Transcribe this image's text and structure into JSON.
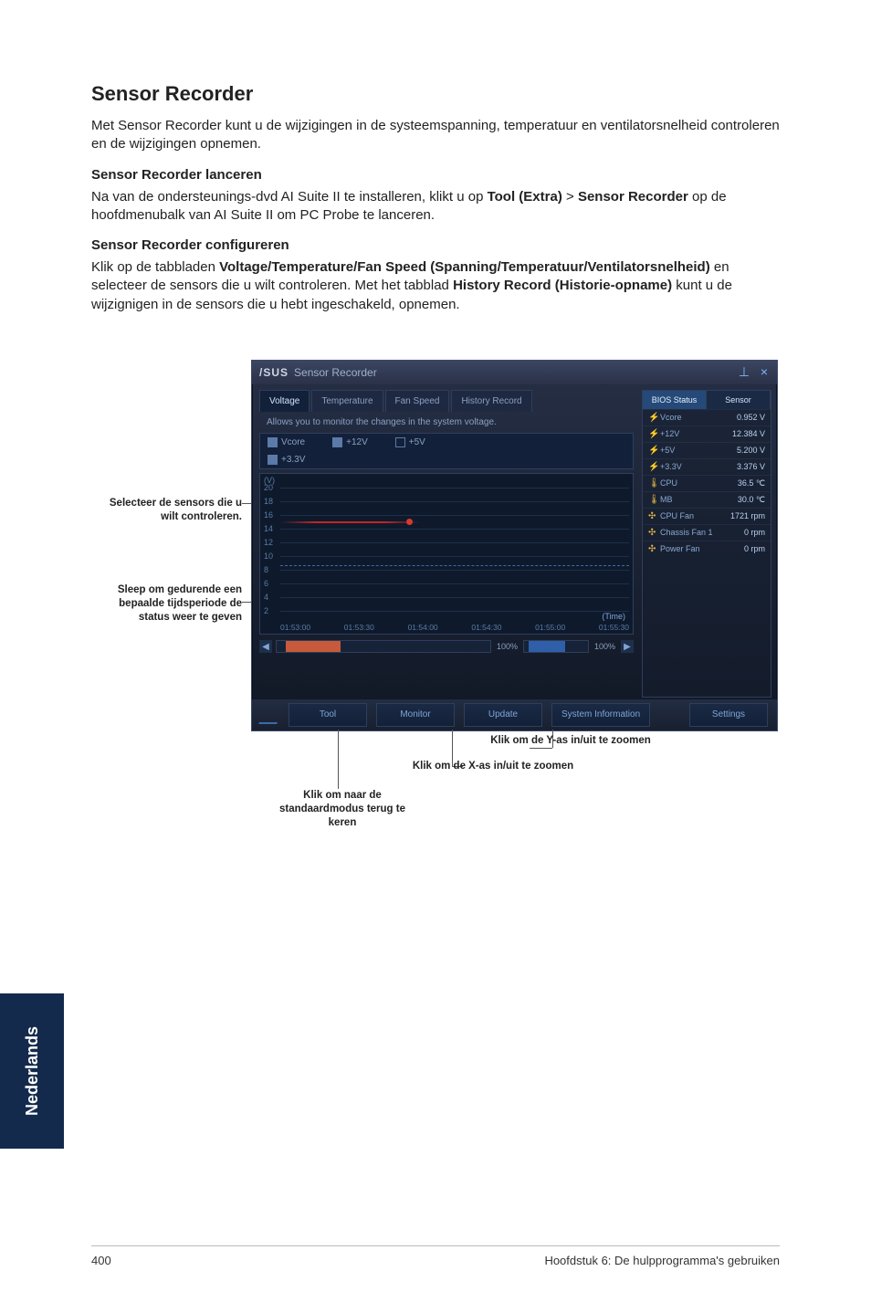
{
  "heading": "Sensor Recorder",
  "intro": "Met Sensor Recorder kunt u de wijzigingen in de systeemspanning, temperatuur en ventilatorsnelheid controleren en de wijzigingen opnemen.",
  "sub1_title": "Sensor Recorder lanceren",
  "sub1_body_pre": "Na van de ondersteunings-dvd AI Suite II te installeren, klikt u op ",
  "sub1_bold": "Tool (Extra)",
  "sub1_mid": " > ",
  "sub1_bold2": "Sensor Recorder",
  "sub1_post": " op de hoofdmenubalk van AI Suite II om PC Probe te lanceren.",
  "sub2_title": "Sensor Recorder configureren",
  "sub2_body_pre": "Klik op de tabbladen ",
  "sub2_bold": "Voltage/Temperature/Fan Speed (Spanning/Temperatuur/Ventilatorsnelheid)",
  "sub2_mid": " en selecteer de sensors die u wilt controleren. Met het tabblad ",
  "sub2_bold2": "History Record (Historie-opname)",
  "sub2_post": " kunt u de wijzignigen in de sensors die u hebt ingeschakeld, opnemen.",
  "left_caption_1": "Selecteer de sensors die u wilt controleren.",
  "left_caption_2": "Sleep om gedurende een bepaalde tijdsperiode de status weer te geven",
  "callout_default": "Klik om naar de standaardmodus terug te keren",
  "callout_zoomx": "Klik om de X-as in/uit te zoomen",
  "callout_zoomy": "Klik om de Y-as in/uit te zoomen",
  "shot": {
    "brand": "/SUS",
    "title": "Sensor Recorder",
    "win_pin": "⊥",
    "win_close": "×",
    "tabs": [
      "Voltage",
      "Temperature",
      "Fan Speed",
      "History Record"
    ],
    "desc": "Allows you to monitor the changes in the system voltage.",
    "checks": {
      "vcore": "Vcore",
      "p12v": "+12V",
      "p5v": "+5V",
      "p33v": "+3.3V"
    },
    "chart": {
      "ylabel": "(V)",
      "yticks": [
        "20",
        "18",
        "16",
        "14",
        "12",
        "10",
        "8",
        "6",
        "4",
        "2"
      ],
      "xticks": [
        "01:53:00",
        "01:53:30",
        "01:54:00",
        "01:54:30",
        "01:55:00",
        "01:55:30"
      ],
      "time_label": "(Time)"
    },
    "scroller": {
      "left": "◀",
      "right": "▶",
      "zoom_x": "100%",
      "zoom_y": "100%"
    },
    "status_head": [
      "BIOS Status",
      "Sensor"
    ],
    "status_rows": [
      {
        "icon": "⚡",
        "label": "Vcore",
        "value": "0.952 V"
      },
      {
        "icon": "⚡",
        "label": "+12V",
        "value": "12.384 V"
      },
      {
        "icon": "⚡",
        "label": "+5V",
        "value": "5.200 V"
      },
      {
        "icon": "⚡",
        "label": "+3.3V",
        "value": "3.376 V"
      },
      {
        "icon": "🌡",
        "label": "CPU",
        "value": "36.5 ℃"
      },
      {
        "icon": "🌡",
        "label": "MB",
        "value": "30.0 ℃"
      },
      {
        "icon": "✣",
        "label": "CPU Fan",
        "value": "1721 rpm"
      },
      {
        "icon": "✣",
        "label": "Chassis Fan 1",
        "value": "0 rpm"
      },
      {
        "icon": "✣",
        "label": "Power Fan",
        "value": "0 rpm"
      }
    ],
    "bottom_buttons": [
      "Tool",
      "Monitor",
      "Update",
      "System Information",
      "Settings"
    ]
  },
  "sidetab_label": "Nederlands",
  "footer_left": "400",
  "footer_right": "Hoofdstuk 6: De hulpprogramma's gebruiken"
}
